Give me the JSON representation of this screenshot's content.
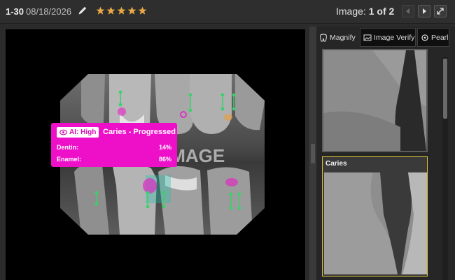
{
  "header": {
    "record_id": "1-30",
    "date": "08/18/2026",
    "rating": 5,
    "image_label": "Image:",
    "image_current": "1",
    "image_of": "of",
    "image_total": "2"
  },
  "viewer": {
    "watermark": "IMAGE",
    "finding": {
      "confidence_label": "AI: High",
      "title": "Caries - Progressed",
      "rows": [
        {
          "label": "Dentin:",
          "value": "14%"
        },
        {
          "label": "Enamel:",
          "value": "86%"
        }
      ]
    }
  },
  "tools": {
    "tabs": [
      {
        "label": "Magnify",
        "icon": "tooth-icon"
      },
      {
        "label": "Image Verify",
        "icon": "image-verify-icon"
      },
      {
        "label": "Pearl",
        "icon": "pearl-icon"
      }
    ]
  },
  "thumbnails": [
    {
      "label": ""
    },
    {
      "label": "Caries"
    }
  ],
  "colors": {
    "accent_magenta": "#ee10c9",
    "star_gold": "#e8a845",
    "selected_border": "#d8c338",
    "marker_green": "#39d16a"
  }
}
